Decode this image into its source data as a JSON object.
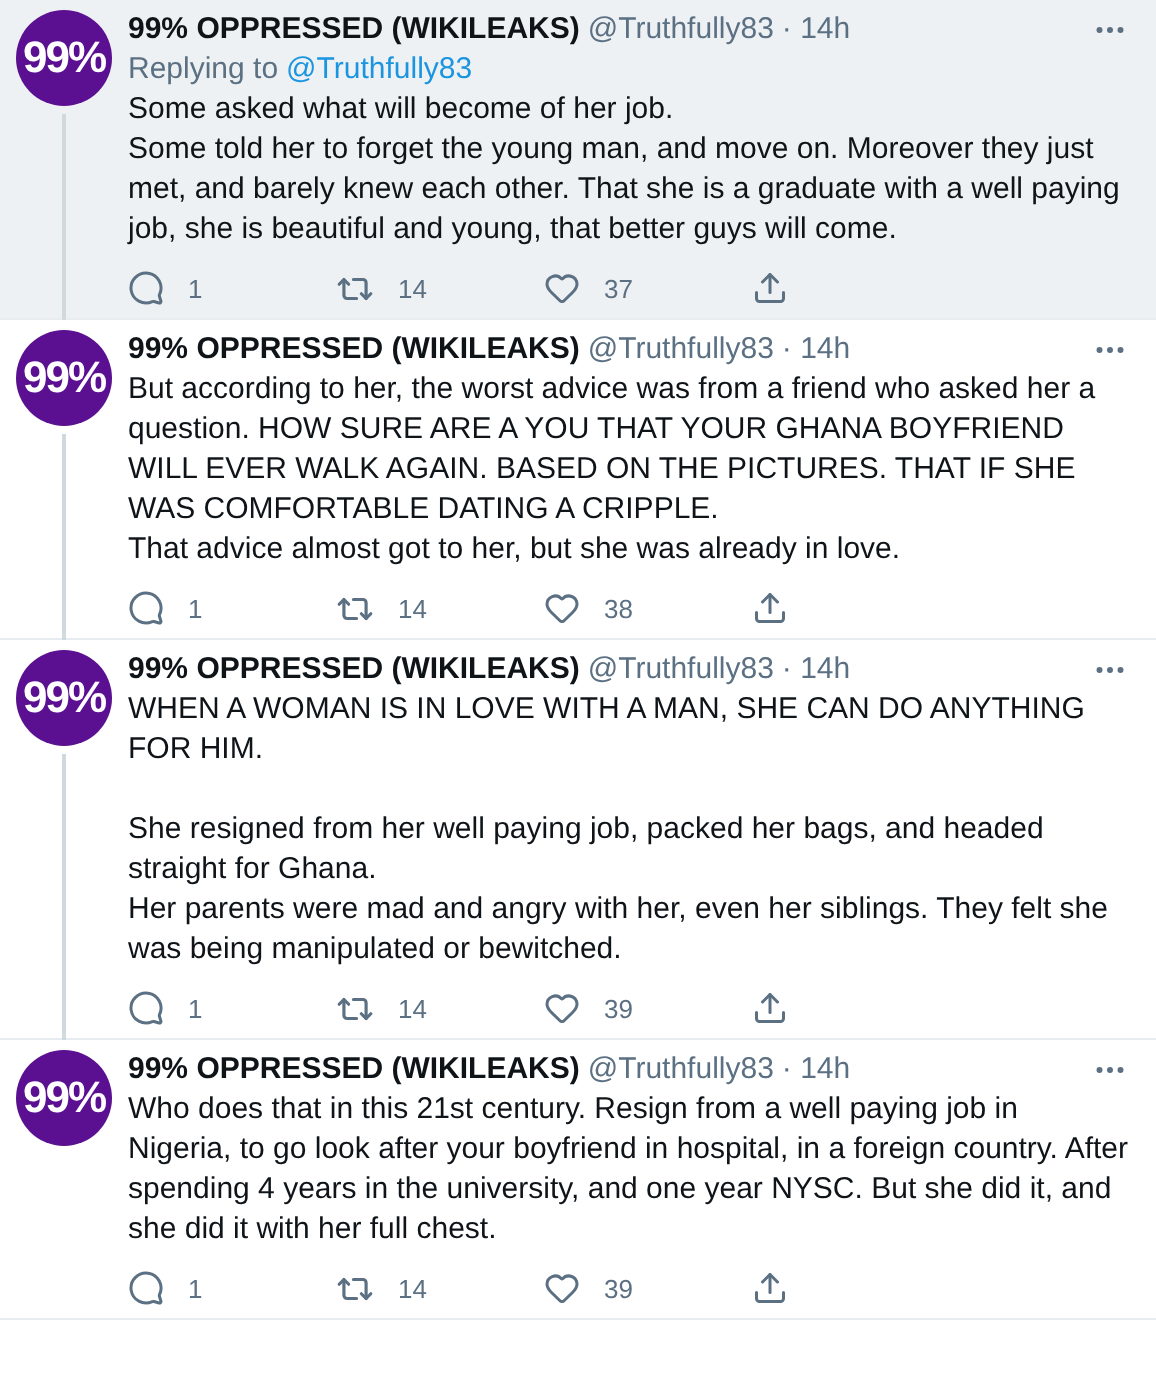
{
  "tweets": [
    {
      "highlighted": true,
      "avatar": "99%",
      "name": "99% OPPRESSED (WIKILEAKS)",
      "handle": "@Truthfully83",
      "time": "· 14h",
      "replying_to": {
        "label": "Replying to",
        "handle": "@Truthfully83"
      },
      "body": "Some asked what will become of her job.\nSome told her to forget the young man, and move on. Moreover they just met, and barely knew each other. That she is a graduate with a well paying job, she is beautiful and young, that better guys will come.",
      "replies": "1",
      "retweets": "14",
      "likes": "37"
    },
    {
      "highlighted": false,
      "avatar": "99%",
      "name": "99% OPPRESSED (WIKILEAKS)",
      "handle": "@Truthfully83",
      "time": "· 14h",
      "body": "But according to her, the worst advice was from a friend who asked her a question. HOW SURE ARE A YOU THAT YOUR GHANA BOYFRIEND WILL EVER WALK AGAIN. BASED ON THE PICTURES. THAT IF SHE WAS COMFORTABLE DATING A CRIPPLE.\nThat advice almost got to her, but she was already in love.",
      "replies": "1",
      "retweets": "14",
      "likes": "38"
    },
    {
      "highlighted": false,
      "avatar": "99%",
      "name": "99% OPPRESSED (WIKILEAKS)",
      "handle": "@Truthfully83",
      "time": "· 14h",
      "body": "WHEN A WOMAN IS IN LOVE WITH A MAN, SHE CAN DO ANYTHING FOR HIM.\n\nShe resigned from her well paying job, packed her bags, and headed straight for Ghana.\nHer parents were mad and angry with her, even her siblings. They felt she was being manipulated or bewitched.",
      "replies": "1",
      "retweets": "14",
      "likes": "39"
    },
    {
      "highlighted": false,
      "avatar": "99%",
      "name": "99% OPPRESSED (WIKILEAKS)",
      "handle": "@Truthfully83",
      "time": "· 14h",
      "body": "Who does that in this 21st century. Resign from a well paying job in Nigeria, to go look after your boyfriend in hospital, in a foreign country. After spending 4 years in the university, and one year NYSC. But she did it, and she did it with her full chest.",
      "replies": "1",
      "retweets": "14",
      "likes": "39"
    }
  ]
}
